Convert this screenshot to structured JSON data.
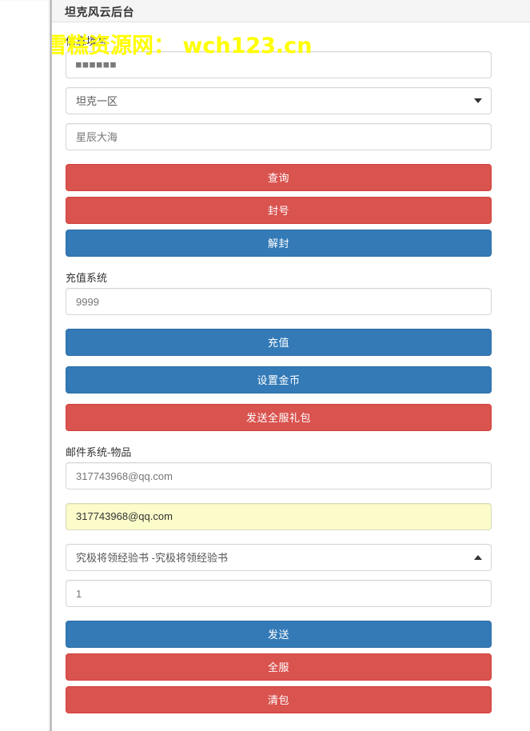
{
  "window": {
    "title": "坦克风云后台"
  },
  "watermark": {
    "text": "雪糕资源网：  wch123.cn",
    "color": "#ffff00"
  },
  "theme": {
    "danger_color": "#d9534f",
    "primary_color": "#337ab7",
    "autofill_color": "#fcfccb",
    "header_bg": "#f5f5f5"
  },
  "sections": {
    "info": {
      "label": "信息填写",
      "password_value": "■■■■■■",
      "password_placeholder": "",
      "server_select_value": "坦克一区",
      "server_select_options": [
        "坦克一区"
      ],
      "nickname_placeholder": "星辰大海",
      "nickname_value": "",
      "buttons": {
        "query": "查询",
        "ban": "封号",
        "unban": "解封"
      }
    },
    "recharge": {
      "label": "充值系统",
      "amount_placeholder": "9999",
      "amount_value": "",
      "buttons": {
        "recharge": "充值",
        "set_coin": "设置金币",
        "send_all_server_gift": "发送全服礼包"
      }
    },
    "mail": {
      "label": "邮件系统-物品",
      "email_placeholder": "317743968@qq.com",
      "email_value": "",
      "email_autofill_value": "317743968@qq.com",
      "item_select_value": "究极将领经验书 -究极将领经验书",
      "item_select_options": [
        "究极将领经验书 -究极将领经验书"
      ],
      "quantity_placeholder": "1",
      "quantity_value": "",
      "buttons": {
        "send": "发送",
        "all_server": "全服",
        "clear_bag": "清包"
      }
    }
  },
  "icons": {
    "chevron_down": "chevron-down-icon",
    "chevron_up": "chevron-up-icon"
  }
}
